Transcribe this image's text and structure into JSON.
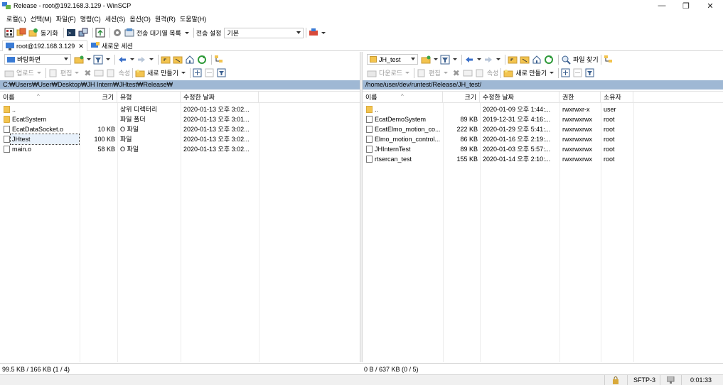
{
  "window": {
    "title": "Release - root@192.168.3.129 - WinSCP",
    "min": "—",
    "max": "❐",
    "close": "✕"
  },
  "menu": [
    "로컬(L)",
    "선택(M)",
    "파일(F)",
    "명령(C)",
    "세션(S)",
    "옵션(O)",
    "원격(R)",
    "도움말(H)"
  ],
  "toolbar": {
    "sync_label": "동기화",
    "queue_label": "전송 대기열 목록",
    "transfer_settings_label": "전송 설정",
    "transfer_preset": "기본"
  },
  "tabs": {
    "session": "root@192.168.3.129",
    "close": "✕",
    "new_session": "새로운 세션"
  },
  "left": {
    "location": "바탕화면",
    "upload": "업로드",
    "edit": "편집",
    "props": "속성",
    "new": "새로 만들기",
    "path": "C:₩Users₩User₩Desktop₩JH Intern₩JHtest₩Release₩",
    "columns": [
      "이름",
      "크기",
      "유형",
      "수정한 날짜"
    ],
    "files": [
      {
        "name": "..",
        "size": "",
        "type": "상위 디렉터리",
        "date": "2020-01-13  오후 3:02...",
        "kind": "up"
      },
      {
        "name": "EcatSystem",
        "size": "",
        "type": "파일 폴더",
        "date": "2020-01-13  오후 3:01...",
        "kind": "folder"
      },
      {
        "name": "EcatDataSocket.o",
        "size": "10 KB",
        "type": "O 파일",
        "date": "2020-01-13  오후 3:02...",
        "kind": "file"
      },
      {
        "name": "JHtest",
        "size": "100 KB",
        "type": "파일",
        "date": "2020-01-13  오후 3:02...",
        "kind": "file"
      },
      {
        "name": "main.o",
        "size": "58 KB",
        "type": "O 파일",
        "date": "2020-01-13  오후 3:02...",
        "kind": "file"
      }
    ],
    "status": "99.5 KB / 166 KB (1 / 4)"
  },
  "right": {
    "location": "JH_test",
    "download": "다운로드",
    "edit": "편집",
    "props": "속성",
    "new": "새로 만들기",
    "find": "파일 찾기",
    "path": "/home/user/dev/runtest/Release/JH_test/",
    "columns": [
      "이름",
      "크기",
      "수정한 날짜",
      "권한",
      "소유자"
    ],
    "files": [
      {
        "name": "..",
        "size": "",
        "date": "2020-01-09  오후 1:44:...",
        "perm": "rwxrwxr-x",
        "owner": "user",
        "kind": "up"
      },
      {
        "name": "EcatDemoSystem",
        "size": "89 KB",
        "date": "2019-12-31  오후 4:16:...",
        "perm": "rwxrwxrwx",
        "owner": "root",
        "kind": "file"
      },
      {
        "name": "EcatElmo_motion_co...",
        "size": "222 KB",
        "date": "2020-01-29  오후 5:41:...",
        "perm": "rwxrwxrwx",
        "owner": "root",
        "kind": "file"
      },
      {
        "name": "Elmo_motion_control...",
        "size": "86 KB",
        "date": "2020-01-16  오후 2:19:...",
        "perm": "rwxrwxrwx",
        "owner": "root",
        "kind": "file"
      },
      {
        "name": "JHInternTest",
        "size": "89 KB",
        "date": "2020-01-03  오후 5:57:...",
        "perm": "rwxrwxrwx",
        "owner": "root",
        "kind": "file"
      },
      {
        "name": "rtsercan_test",
        "size": "155 KB",
        "date": "2020-01-14  오후 2:10:...",
        "perm": "rwxrwxrwx",
        "owner": "root",
        "kind": "file"
      }
    ],
    "status": "0 B / 637 KB (0 / 5)"
  },
  "statusbar": {
    "protocol": "SFTP-3",
    "elapsed": "0:01:33"
  }
}
